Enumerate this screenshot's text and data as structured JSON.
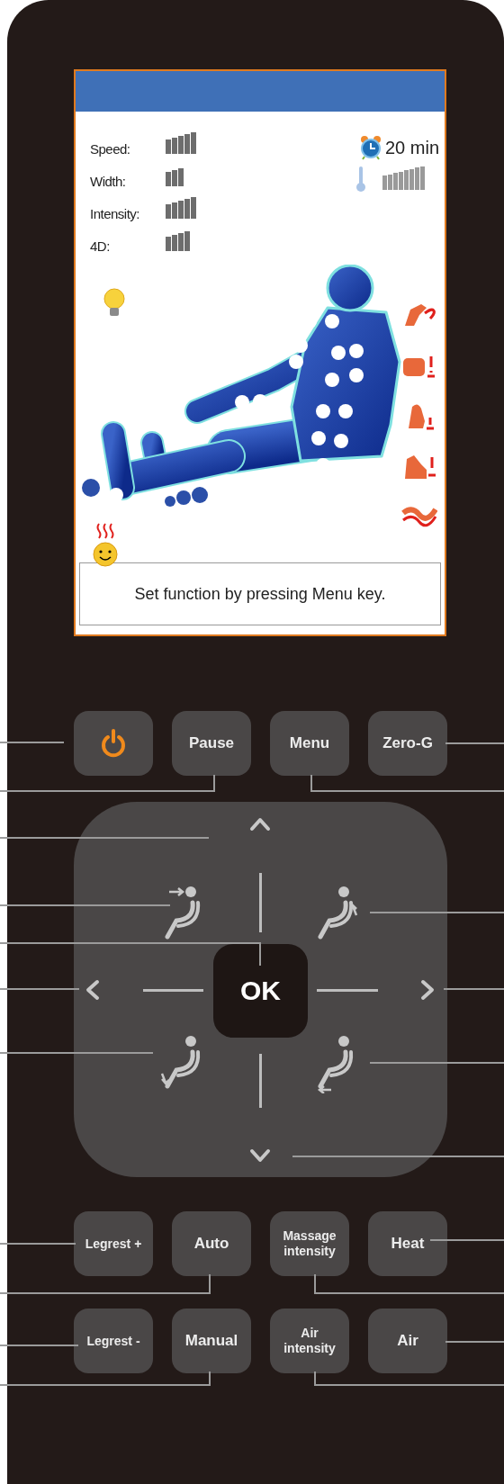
{
  "screen": {
    "stats": [
      {
        "label": "Speed:",
        "level": 1
      },
      {
        "label": "Width:",
        "level": 0.6
      },
      {
        "label": "Intensity:",
        "level": 1
      },
      {
        "label": "4D:",
        "level": 0.8
      }
    ],
    "timer": "20 min",
    "temperature": {
      "level": 1
    },
    "message": "Set function by pressing Menu key."
  },
  "top_buttons": [
    {
      "kind": "power"
    },
    {
      "kind": "text",
      "label": "Pause"
    },
    {
      "kind": "text",
      "label": "Menu"
    },
    {
      "kind": "text",
      "label": "Zero-G"
    }
  ],
  "dpad": {
    "ok": "OK"
  },
  "bottom_buttons": [
    {
      "kind": "text",
      "label": "Legrest +",
      "small": true
    },
    {
      "kind": "text",
      "label": "Auto"
    },
    {
      "kind": "text",
      "label": "Massage intensity",
      "small": true
    },
    {
      "kind": "text",
      "label": "Heat"
    },
    {
      "kind": "text",
      "label": "Legrest -",
      "small": true
    },
    {
      "kind": "text",
      "label": "Manual"
    },
    {
      "kind": "text",
      "label": "Air intensity",
      "small": true
    },
    {
      "kind": "text",
      "label": "Air"
    }
  ]
}
